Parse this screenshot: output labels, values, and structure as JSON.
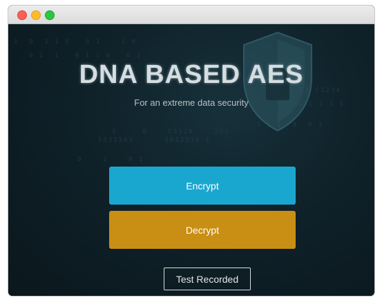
{
  "window": {
    "title": "",
    "traffic_lights": [
      "close",
      "minimize",
      "zoom"
    ]
  },
  "hero": {
    "title": "DNA BASED AES",
    "subtitle": "For an extreme data security"
  },
  "actions": {
    "encrypt_label": "Encrypt",
    "decrypt_label": "Decrypt",
    "record_label": "Test Recorded"
  },
  "colors": {
    "background": "#0e1b22",
    "encrypt": "#1aa7cf",
    "decrypt": "#c98e14",
    "outline": "#d9dde0"
  },
  "background_icon": "shield-icon"
}
